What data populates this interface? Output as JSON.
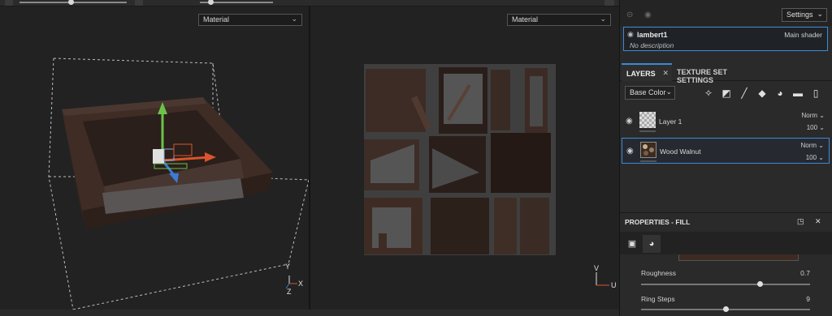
{
  "viewports": {
    "left_mode": "Material",
    "right_mode": "Material",
    "axes_3d": {
      "y": "Y",
      "x": "X",
      "z": "Z"
    },
    "axes_2d": {
      "v": "V",
      "u": "U"
    }
  },
  "panel": {
    "settings_label": "Settings",
    "shader": {
      "name": "lambert1",
      "type": "Main shader",
      "description": "No description"
    },
    "tabs": {
      "layers": "LAYERS",
      "texture_set_settings": "TEXTURE SET SETTINGS"
    },
    "channel": "Base Color",
    "layers": [
      {
        "name": "Layer 1",
        "blend": "Norm",
        "opacity": "100"
      },
      {
        "name": "Wood Walnut",
        "blend": "Norm",
        "opacity": "100"
      }
    ],
    "properties": {
      "title": "PROPERTIES - FILL",
      "roughness_label": "Roughness",
      "roughness_value": "0.7",
      "roughness_level": 0.7,
      "ring_steps_label": "Ring Steps",
      "ring_steps_value": "9",
      "ring_steps_level": 0.5
    }
  },
  "colors": {
    "accent": "#3b8ad8",
    "wood_dark": "#3a2a22",
    "background": "#222222"
  }
}
